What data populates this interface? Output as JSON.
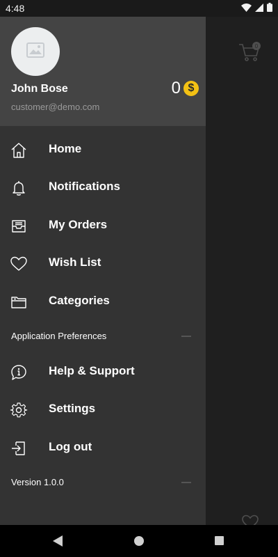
{
  "status_bar": {
    "time": "4:48",
    "icons": [
      "wifi-icon",
      "signal-icon",
      "battery-icon"
    ]
  },
  "header": {
    "user_name": "John Bose",
    "user_email": "customer@demo.com",
    "points": "0",
    "coin_symbol": "$",
    "avatar_icon": "image-placeholder-icon"
  },
  "menu": {
    "primary": [
      {
        "label": "Home",
        "icon": "home-icon"
      },
      {
        "label": "Notifications",
        "icon": "bell-icon"
      },
      {
        "label": "My Orders",
        "icon": "inbox-tray-icon"
      },
      {
        "label": "Wish List",
        "icon": "heart-icon"
      },
      {
        "label": "Categories",
        "icon": "folder-icon"
      }
    ],
    "preferences_header": "Application Preferences",
    "secondary": [
      {
        "label": "Help & Support",
        "icon": "info-chat-icon"
      },
      {
        "label": "Settings",
        "icon": "gear-icon"
      },
      {
        "label": "Log out",
        "icon": "logout-icon"
      }
    ],
    "version": "Version 1.0.0"
  },
  "background": {
    "cart_badge": "0",
    "cart_icon": "cart-icon",
    "heart_icon": "heart-outline-icon"
  },
  "colors": {
    "drawer_bg": "#333333",
    "header_bg": "#444444",
    "coin": "#f3c114",
    "text": "#ffffff",
    "muted_text": "#9a9a9a"
  }
}
